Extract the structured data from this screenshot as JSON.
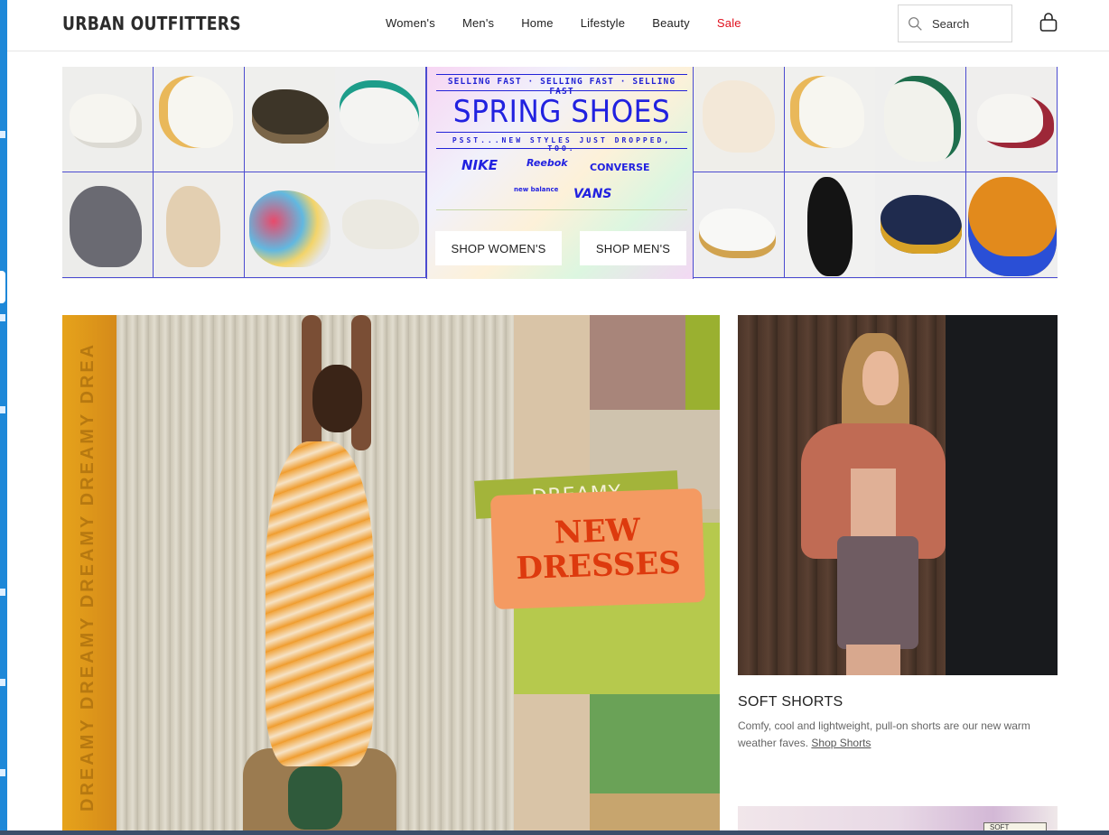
{
  "header": {
    "logo": "URBAN OUTFITTERS",
    "nav": [
      "Women's",
      "Men's",
      "Home",
      "Lifestyle",
      "Beauty",
      "Sale"
    ],
    "search_label": "Search"
  },
  "hero": {
    "selling_fast": "SELLING FAST · SELLING FAST · SELLING FAST",
    "title": "SPRING SHOES",
    "subtitle": "PSST...NEW STYLES JUST DROPPED, TOO.",
    "brands": [
      "NIKE",
      "Reebok",
      "CONVERSE",
      "new balance",
      "VANS"
    ],
    "cta_women": "SHOP WOMEN'S",
    "cta_men": "SHOP MEN'S"
  },
  "feature": {
    "side_text": "DREAMY DREAMY DREAMY DREAMY DREAMY DREAMY",
    "tag_top": "DREAMY",
    "tag_line1": "NEW",
    "tag_line2": "DRESSES"
  },
  "soft_shorts": {
    "title": "SOFT SHORTS",
    "description": "Comfy, cool and lightweight, pull-on shorts are our new warm weather faves.",
    "link": "Shop Shorts"
  },
  "peek": {
    "label": "SOFT"
  },
  "colors": {
    "sale": "#e0101e",
    "hero_blue": "#2121e0",
    "accent_green": "#a3b43a",
    "accent_orange": "#f49a62"
  }
}
